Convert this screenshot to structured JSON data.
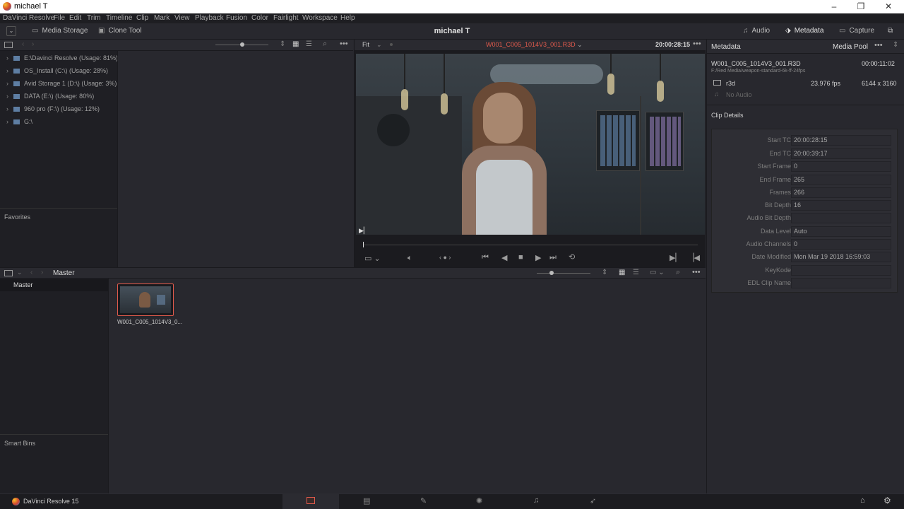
{
  "window": {
    "title": "michael T",
    "controls": [
      "minimize-icon",
      "restore-icon",
      "close-icon"
    ]
  },
  "menu": [
    "DaVinci Resolve",
    "File",
    "Edit",
    "Trim",
    "Timeline",
    "Clip",
    "Mark",
    "View",
    "Playback",
    "Fusion",
    "Color",
    "Fairlight",
    "Workspace",
    "Help"
  ],
  "toolbar": {
    "media_storage": "Media Storage",
    "clone_tool": "Clone Tool",
    "project_title": "michael T",
    "audio": "Audio",
    "metadata": "Metadata",
    "capture": "Capture"
  },
  "storage": {
    "drives": [
      "E:\\Davinci Resolve (Usage: 81%)",
      "OS_Install (C:\\) (Usage: 28%)",
      "Avid Storage 1 (D:\\) (Usage: 3%)",
      "DATA (E:\\) (Usage: 80%)",
      "960 pro (F:\\) (Usage: 12%)",
      "G:\\"
    ],
    "favorites": "Favorites"
  },
  "viewer": {
    "fit": "Fit",
    "clip_name": "W001_C005_1014V3_001.R3D",
    "timecode": "20:00:28:15"
  },
  "metadata_panel": {
    "title": "Metadata",
    "media_pool": "Media Pool",
    "clip_file": "W001_C005_1014V3_001.R3D",
    "duration": "00:00:11:02",
    "path": "F:/Red Media/weapon-standard-6k-ff-24fps",
    "format": "r3d",
    "fps": "23.976 fps",
    "resolution": "6144 x 3160",
    "audio": "No Audio",
    "clip_details": "Clip Details",
    "fields": [
      {
        "k": "Start TC",
        "v": "20:00:28:15"
      },
      {
        "k": "End TC",
        "v": "20:00:39:17"
      },
      {
        "k": "Start Frame",
        "v": "0"
      },
      {
        "k": "End Frame",
        "v": "265"
      },
      {
        "k": "Frames",
        "v": "266"
      },
      {
        "k": "Bit Depth",
        "v": "16"
      },
      {
        "k": "Audio Bit Depth",
        "v": ""
      },
      {
        "k": "Data Level",
        "v": "Auto"
      },
      {
        "k": "Audio Channels",
        "v": "0"
      },
      {
        "k": "Date Modified",
        "v": "Mon Mar 19 2018 16:59:03"
      },
      {
        "k": "KeyKode",
        "v": ""
      },
      {
        "k": "EDL Clip Name",
        "v": ""
      }
    ]
  },
  "pool": {
    "bin": "Master",
    "master_item": "Master",
    "smart_bins": "Smart Bins",
    "clip_label": "W001_C005_1014V3_0..."
  },
  "status": {
    "app": "DaVinci Resolve 15"
  },
  "colors": {
    "accent": "#e05a4c",
    "bg": "#28282e",
    "panel": "#1f1f24"
  }
}
